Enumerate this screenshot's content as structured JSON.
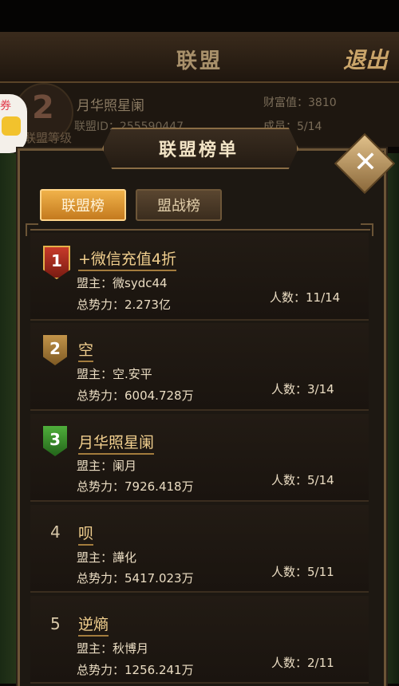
{
  "background": {
    "header_title": "联盟",
    "exit_label": "退出",
    "level_number": "2",
    "level_label": "联盟等级",
    "alliance_name": "月华照星阑",
    "alliance_id": "联盟ID：255590447",
    "wealth": "财富值：3810",
    "members": "成员：5/14",
    "coupon_label": "券"
  },
  "modal": {
    "title": "联盟榜单",
    "close_label": "✕",
    "tabs": [
      {
        "label": "联盟榜",
        "active": true
      },
      {
        "label": "盟战榜",
        "active": false
      }
    ]
  },
  "rankings": [
    {
      "rank": "1",
      "name": "+微信充值4折",
      "leader": "盟主：微sydc44",
      "power": "总势力：2.273亿",
      "count": "人数：11/14"
    },
    {
      "rank": "2",
      "name": "空",
      "leader": "盟主：空.安平",
      "power": "总势力：6004.728万",
      "count": "人数：3/14"
    },
    {
      "rank": "3",
      "name": "月华照星阑",
      "leader": "盟主：阑月",
      "power": "总势力：7926.418万",
      "count": "人数：5/14"
    },
    {
      "rank": "4",
      "name": "呗",
      "leader": "盟主：譁化",
      "power": "总势力：5417.023万",
      "count": "人数：5/11"
    },
    {
      "rank": "5",
      "name": "逆熵",
      "leader": "盟主：秋博月",
      "power": "总势力：1256.241万",
      "count": "人数：2/11"
    }
  ],
  "colors": {
    "accent_gold": "#f1cf8e",
    "tab_active": "#e09a34",
    "panel_bg": "#1d1812"
  }
}
